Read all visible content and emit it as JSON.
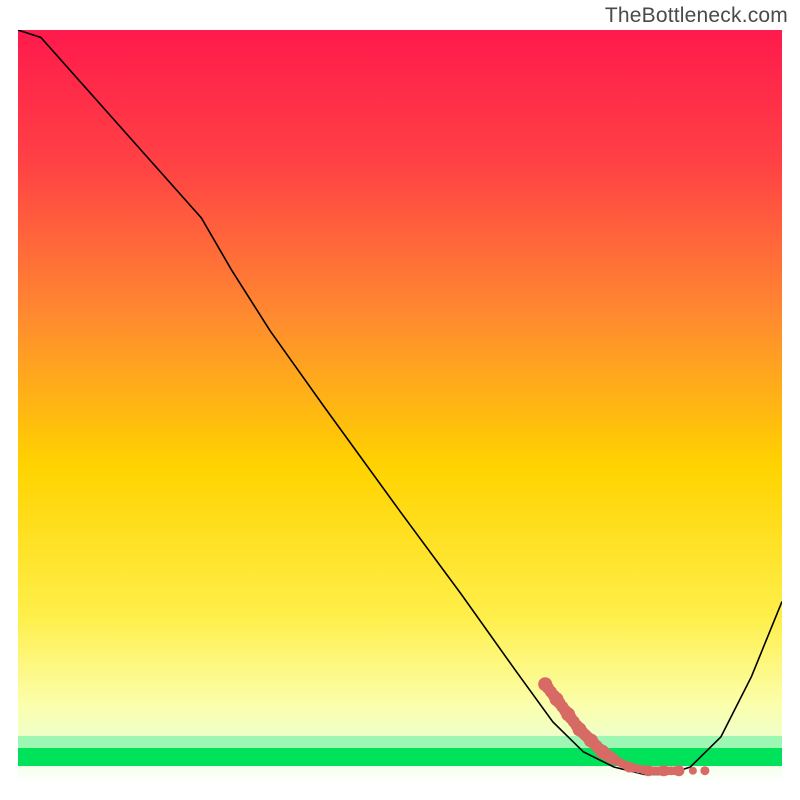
{
  "watermark": "TheBottleneck.com",
  "colors": {
    "curve": "#000000",
    "green": "#00e25a",
    "marker": "#d86a66",
    "gradient_top": "#ff1a4c",
    "gradient_mid_upper": "#ff6e3d",
    "gradient_mid": "#ffd300",
    "gradient_mid_lower": "#ffef4a",
    "gradient_lower": "#fbffae"
  },
  "chart_data": {
    "type": "line",
    "title": "",
    "xlabel": "",
    "ylabel": "",
    "xlim": [
      0,
      100
    ],
    "ylim": [
      0,
      100
    ],
    "x": [
      0,
      3,
      24,
      28,
      33,
      40,
      50,
      58,
      65,
      70,
      74,
      78,
      82,
      85,
      88,
      92,
      96,
      100
    ],
    "values": [
      100,
      99,
      75,
      68,
      60,
      50,
      36,
      25,
      15,
      8,
      4,
      2,
      1,
      1,
      2,
      6,
      14,
      24
    ],
    "annotations_x": [
      69,
      70.5,
      72,
      73.5,
      75,
      76.5,
      78,
      80,
      82.5,
      84.5,
      86.5
    ],
    "annotations_y": [
      13,
      11,
      9,
      7,
      5.5,
      4,
      3,
      2,
      1.5,
      1.5,
      1.5
    ],
    "green_band_y_range": [
      0,
      4
    ]
  }
}
